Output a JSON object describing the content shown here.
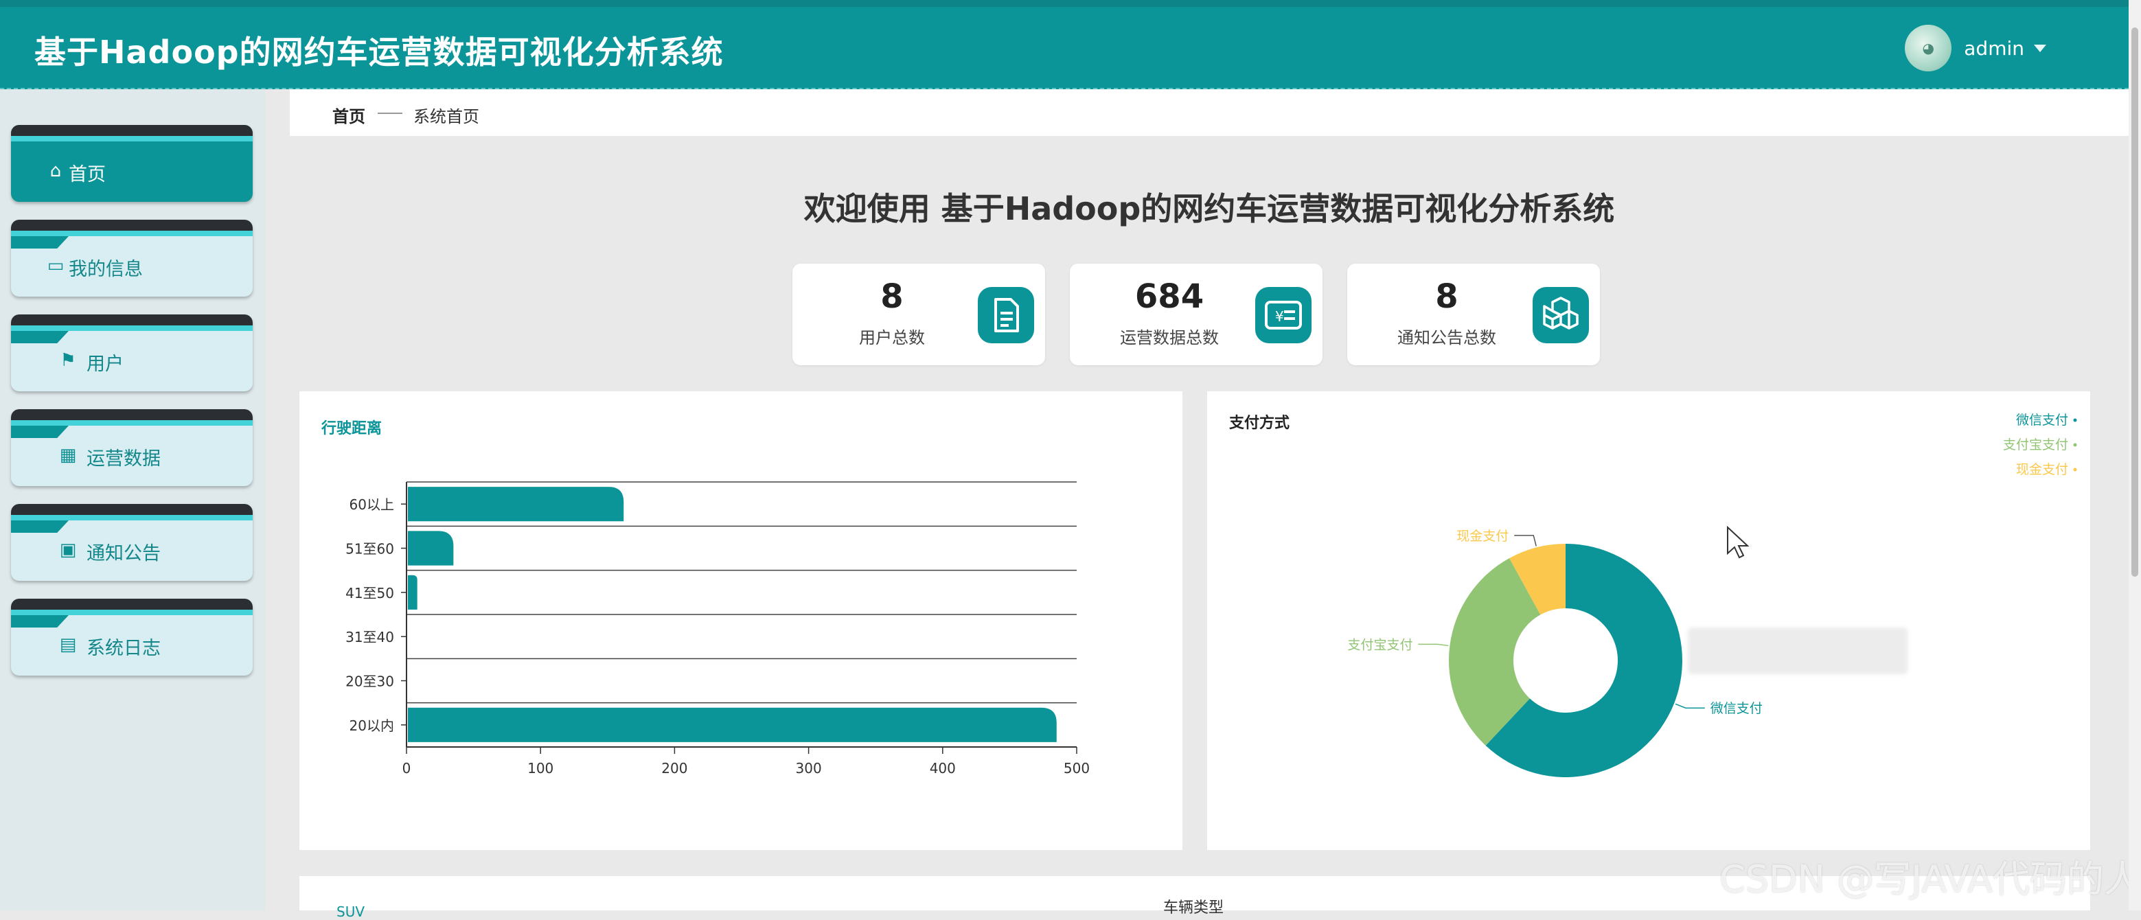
{
  "header": {
    "title": "基于Hadoop的网约车运营数据可视化分析系统",
    "user": "admin"
  },
  "sidebar": {
    "items": [
      {
        "label": "首页",
        "icon": "home-icon"
      },
      {
        "label": "我的信息",
        "icon": "card-icon"
      },
      {
        "label": "用户",
        "icon": "flag-icon"
      },
      {
        "label": "运营数据",
        "icon": "grid-icon"
      },
      {
        "label": "通知公告",
        "icon": "briefcase-icon"
      },
      {
        "label": "系统日志",
        "icon": "clipboard-icon"
      }
    ]
  },
  "breadcrumb": {
    "home": "首页",
    "current": "系统首页"
  },
  "welcome": "欢迎使用 基于Hadoop的网约车运营数据可视化分析系统",
  "stats": [
    {
      "value": "8",
      "label": "用户总数",
      "icon": "document-icon"
    },
    {
      "value": "684",
      "label": "运营数据总数",
      "icon": "yen-list-icon"
    },
    {
      "value": "8",
      "label": "通知公告总数",
      "icon": "cubes-icon"
    }
  ],
  "chart_data": [
    {
      "type": "bar",
      "orientation": "horizontal",
      "title": "行驶距离",
      "categories": [
        "20以内",
        "20至30",
        "31至40",
        "41至50",
        "51至60",
        "60以上"
      ],
      "values": [
        484,
        0,
        0,
        7,
        34,
        161
      ],
      "xlim": [
        0,
        500
      ],
      "xticks": [
        0,
        100,
        200,
        300,
        400,
        500
      ],
      "colors": {
        "bar": "#0c9598"
      }
    },
    {
      "type": "pie",
      "donut": true,
      "title": "支付方式",
      "labels": [
        "微信支付",
        "支付宝支付",
        "现金支付"
      ],
      "values": [
        62,
        30,
        8
      ],
      "colors": [
        "#0c9598",
        "#91c574",
        "#fbc84d"
      ],
      "legend": "top-right"
    }
  ],
  "bottom": {
    "title": "车辆类型",
    "legend": "SUV"
  },
  "watermark": "CSDN @写JAVA代码的人"
}
